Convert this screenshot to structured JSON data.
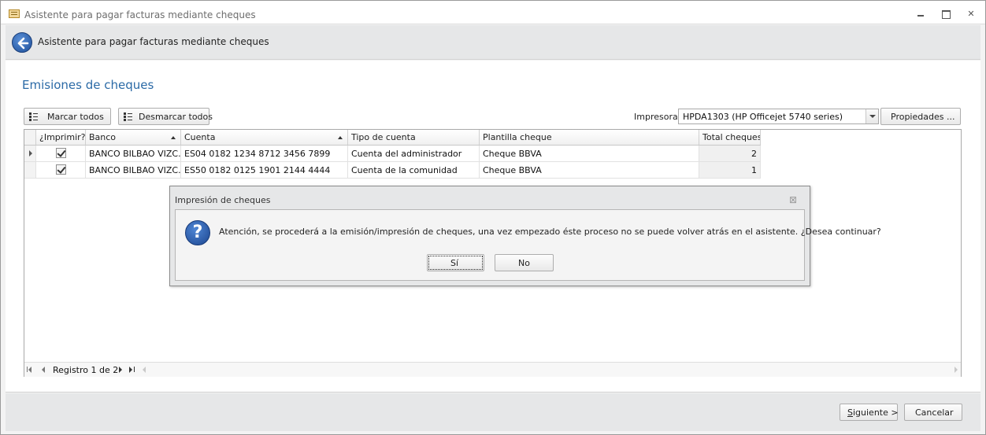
{
  "window": {
    "title": "Asistente para pagar facturas mediante cheques",
    "close_glyph": "✕"
  },
  "wizard": {
    "header_title": "Asistente para pagar facturas mediante cheques",
    "section_title": "Emisiones de cheques"
  },
  "toolbar": {
    "marcar_label": "Marcar todos",
    "desmarcar_label": "Desmarcar todos",
    "printer_label": "Impresora:",
    "printer_value": "HPDA1303 (HP Officejet 5740 series)",
    "properties_label": "Propiedades ..."
  },
  "grid": {
    "columns": [
      "¿Imprimir?",
      "Banco",
      "Cuenta",
      "Tipo de cuenta",
      "Plantilla cheque",
      "Total cheques"
    ],
    "rows": [
      {
        "imprimir": true,
        "banco": "BANCO BILBAO VIZC...",
        "cuenta": "ES04 0182 1234 8712 3456 7899",
        "tipo": "Cuenta del administrador",
        "plantilla": "Cheque BBVA",
        "total": "2"
      },
      {
        "imprimir": true,
        "banco": "BANCO BILBAO VIZC...",
        "cuenta": "ES50 0182 0125 1901 2144 4444",
        "tipo": "Cuenta de la comunidad",
        "plantilla": "Cheque BBVA",
        "total": "1"
      }
    ],
    "navigator_text": "Registro 1 de 2"
  },
  "footer": {
    "next_label_underlined": "S",
    "next_label_rest": "iguiente >",
    "cancel_label": "Cancelar"
  },
  "dialog": {
    "title": "Impresión de cheques",
    "close_glyph": "⊠",
    "icon": "question-icon",
    "icon_glyph": "?",
    "message": "Atención, se procederá a la emisión/impresión de cheques, una vez empezado éste proceso no se puede volver atrás en el asistente. ¿Desea continuar?",
    "yes_label": "Sí",
    "no_label": "No"
  }
}
